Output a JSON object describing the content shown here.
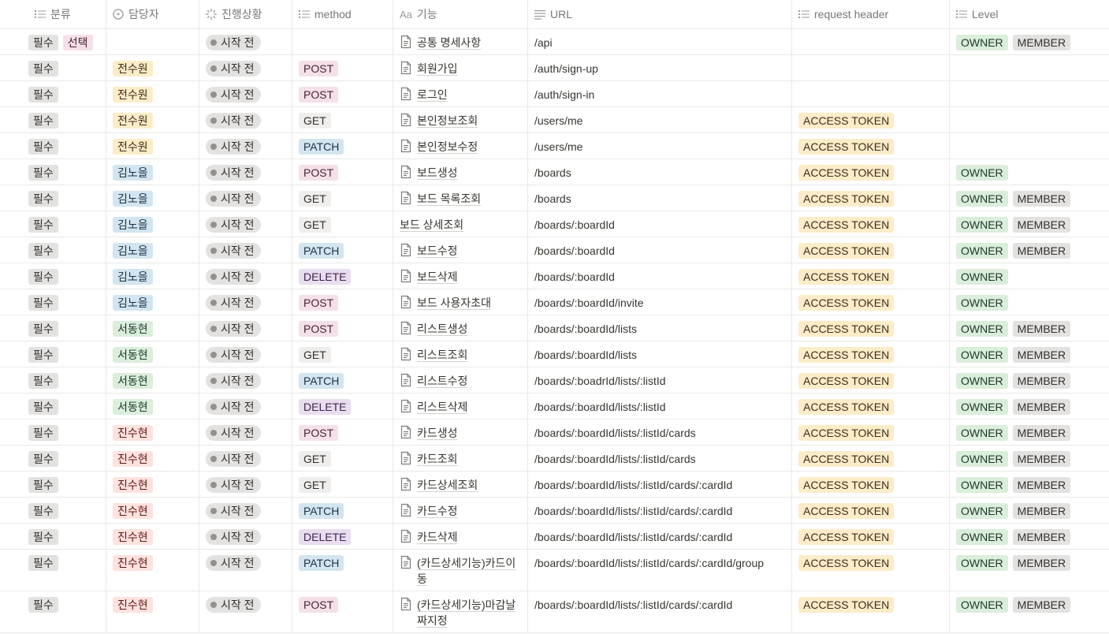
{
  "headers": {
    "category": "분류",
    "owner": "담당자",
    "status": "진행상황",
    "method": "method",
    "feature": "기능",
    "url": "URL",
    "request_header": "request header",
    "level": "Level",
    "feature_prefix": "Aa"
  },
  "rows": [
    {
      "category": [
        "필수",
        "선택"
      ],
      "owner": "",
      "status": "시작 전",
      "method": "",
      "feature": "공통 명세사항",
      "url": "/api",
      "req": "",
      "levels": [
        "OWNER",
        "MEMBER"
      ]
    },
    {
      "category": [
        "필수"
      ],
      "owner": "전수원",
      "status": "시작 전",
      "method": "POST",
      "feature": "회원가입",
      "url": "/auth/sign-up",
      "req": "",
      "levels": []
    },
    {
      "category": [
        "필수"
      ],
      "owner": "전수원",
      "status": "시작 전",
      "method": "POST",
      "feature": "로그인",
      "url": "/auth/sign-in",
      "req": "",
      "levels": []
    },
    {
      "category": [
        "필수"
      ],
      "owner": "전수원",
      "status": "시작 전",
      "method": "GET",
      "feature": "본인정보조회",
      "url": "/users/me",
      "req": "ACCESS TOKEN",
      "levels": []
    },
    {
      "category": [
        "필수"
      ],
      "owner": "전수원",
      "status": "시작 전",
      "method": "PATCH",
      "feature": "본인정보수정",
      "url": "/users/me",
      "req": "ACCESS TOKEN",
      "levels": []
    },
    {
      "category": [
        "필수"
      ],
      "owner": "김노을",
      "status": "시작 전",
      "method": "POST",
      "feature": "보드생성",
      "url": "/boards",
      "req": "ACCESS TOKEN",
      "levels": [
        "OWNER"
      ]
    },
    {
      "category": [
        "필수"
      ],
      "owner": "김노을",
      "status": "시작 전",
      "method": "GET",
      "feature": "보드 목록조회",
      "url": "/boards",
      "req": "ACCESS TOKEN",
      "levels": [
        "OWNER",
        "MEMBER"
      ]
    },
    {
      "category": [
        "필수"
      ],
      "owner": "김노을",
      "status": "시작 전",
      "method": "GET",
      "feature": "보드 상세조회",
      "url": "/boards/:boardId",
      "req": "ACCESS TOKEN",
      "levels": [
        "OWNER",
        "MEMBER"
      ],
      "noicon": true
    },
    {
      "category": [
        "필수"
      ],
      "owner": "김노을",
      "status": "시작 전",
      "method": "PATCH",
      "feature": "보드수정",
      "url": "/boards/:boardId",
      "req": "ACCESS TOKEN",
      "levels": [
        "OWNER",
        "MEMBER"
      ]
    },
    {
      "category": [
        "필수"
      ],
      "owner": "김노을",
      "status": "시작 전",
      "method": "DELETE",
      "feature": "보드삭제",
      "url": "/boards/:boardId",
      "req": "ACCESS TOKEN",
      "levels": [
        "OWNER"
      ]
    },
    {
      "category": [
        "필수"
      ],
      "owner": "김노을",
      "status": "시작 전",
      "method": "POST",
      "feature": "보드 사용자초대",
      "url": "/boards/:boardId/invite",
      "req": "ACCESS TOKEN",
      "levels": [
        "OWNER"
      ]
    },
    {
      "category": [
        "필수"
      ],
      "owner": "서동현",
      "status": "시작 전",
      "method": "POST",
      "feature": "리스트생성",
      "url": "/boards/:boardId/lists",
      "req": "ACCESS TOKEN",
      "levels": [
        "OWNER",
        "MEMBER"
      ]
    },
    {
      "category": [
        "필수"
      ],
      "owner": "서동현",
      "status": "시작 전",
      "method": "GET",
      "feature": "리스트조회",
      "url": "/boards/:boardId/lists",
      "req": "ACCESS TOKEN",
      "levels": [
        "OWNER",
        "MEMBER"
      ]
    },
    {
      "category": [
        "필수"
      ],
      "owner": "서동현",
      "status": "시작 전",
      "method": "PATCH",
      "feature": "리스트수정",
      "url": "/boards/:boadrId/lists/:listId",
      "req": "ACCESS TOKEN",
      "levels": [
        "OWNER",
        "MEMBER"
      ]
    },
    {
      "category": [
        "필수"
      ],
      "owner": "서동현",
      "status": "시작 전",
      "method": "DELETE",
      "feature": "리스트삭제",
      "url": "/boards/:boardId/lists/:listId",
      "req": "ACCESS TOKEN",
      "levels": [
        "OWNER",
        "MEMBER"
      ]
    },
    {
      "category": [
        "필수"
      ],
      "owner": "진수현",
      "status": "시작 전",
      "method": "POST",
      "feature": "카드생성",
      "url": "/boards/:boardId/lists/:listId/cards",
      "req": "ACCESS TOKEN",
      "levels": [
        "OWNER",
        "MEMBER"
      ]
    },
    {
      "category": [
        "필수"
      ],
      "owner": "진수현",
      "status": "시작 전",
      "method": "GET",
      "feature": "카드조회",
      "url": "/boards/:boardId/lists/:listId/cards",
      "req": "ACCESS TOKEN",
      "levels": [
        "OWNER",
        "MEMBER"
      ]
    },
    {
      "category": [
        "필수"
      ],
      "owner": "진수현",
      "status": "시작 전",
      "method": "GET",
      "feature": "카드상세조회",
      "url": "/boards/:boardId/lists/:listId/cards/:cardId",
      "req": "ACCESS TOKEN",
      "levels": [
        "OWNER",
        "MEMBER"
      ]
    },
    {
      "category": [
        "필수"
      ],
      "owner": "진수현",
      "status": "시작 전",
      "method": "PATCH",
      "feature": "카드수정",
      "url": "/boards/:boardId/lists/:listId/cards/:cardId",
      "req": "ACCESS TOKEN",
      "levels": [
        "OWNER",
        "MEMBER"
      ]
    },
    {
      "category": [
        "필수"
      ],
      "owner": "진수현",
      "status": "시작 전",
      "method": "DELETE",
      "feature": "카드삭제",
      "url": "/boards/:boardId/lists/:listId/cards/:cardId",
      "req": "ACCESS TOKEN",
      "levels": [
        "OWNER",
        "MEMBER"
      ]
    },
    {
      "category": [
        "필수"
      ],
      "owner": "진수현",
      "status": "시작 전",
      "method": "PATCH",
      "feature": "(카드상세기능)카드이동",
      "url": "/boards/:boardId/lists/:listId/cards/:cardId/group",
      "req": "ACCESS TOKEN",
      "levels": [
        "OWNER",
        "MEMBER"
      ],
      "tall": true
    },
    {
      "category": [
        "필수"
      ],
      "owner": "진수현",
      "status": "시작 전",
      "method": "POST",
      "feature": "(카드상세기능)마감날짜지정",
      "url": "/boards/:boardId/lists/:listId/cards/:cardId",
      "req": "ACCESS TOKEN",
      "levels": [
        "OWNER",
        "MEMBER"
      ],
      "tall": true
    }
  ],
  "colors": {
    "owner": {
      "전수원": "yellow",
      "김노을": "blue",
      "서동현": "green",
      "진수현": "red"
    },
    "method": {
      "POST": "pink",
      "GET": "lightgray",
      "PATCH": "blue",
      "DELETE": "purple"
    },
    "category": {
      "필수": "gray",
      "선택": "pink"
    },
    "level": {
      "OWNER": "green",
      "MEMBER": "gray"
    },
    "req": "yellow"
  }
}
